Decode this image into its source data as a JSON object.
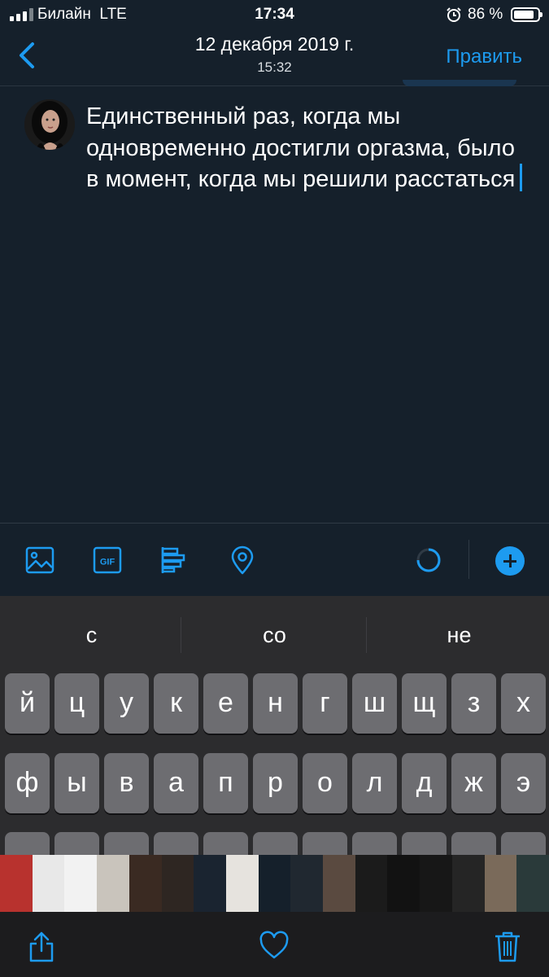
{
  "status": {
    "carrier": "Билайн",
    "network": "LTE",
    "time": "17:34",
    "battery": "86 %",
    "battery_level": 0.86
  },
  "nav": {
    "date": "12 декабря 2019 г.",
    "time": "15:32",
    "edit_label": "Править"
  },
  "compose": {
    "text": "Единственный раз, когда мы одновременно достигли оргазма, было в момент, когда мы решили расстаться"
  },
  "toolbar": {
    "icons": [
      "image-icon",
      "gif-icon",
      "poll-icon",
      "location-icon",
      "progress-ring-icon",
      "add-thread-icon"
    ]
  },
  "keyboard": {
    "suggestions": [
      "с",
      "со",
      "не"
    ],
    "row1": [
      "й",
      "ц",
      "у",
      "к",
      "е",
      "н",
      "г",
      "ш",
      "щ",
      "з",
      "х"
    ],
    "row2": [
      "ф",
      "ы",
      "в",
      "а",
      "п",
      "р",
      "о",
      "л",
      "д",
      "ж",
      "э"
    ]
  },
  "bottom_bar": {
    "icons": [
      "share-icon",
      "heart-icon",
      "trash-icon"
    ]
  },
  "colors": {
    "background": "#15202b",
    "accent": "#1d9bf0",
    "key": "#6d6d71",
    "keyboard_bg": "#2c2c2e"
  }
}
